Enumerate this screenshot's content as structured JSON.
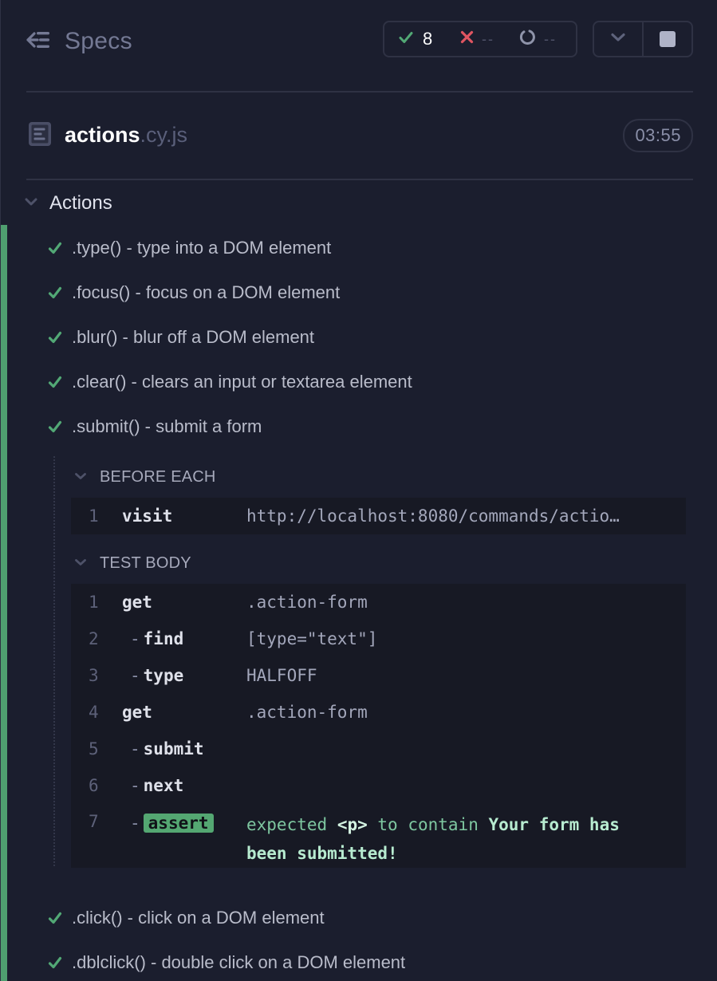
{
  "header": {
    "specs_label": "Specs",
    "stats": {
      "passed": "8",
      "failed": "--",
      "pending": "--"
    },
    "controls": {
      "toggle_icon": "chevron-down-icon",
      "stop_icon": "stop-icon"
    }
  },
  "file": {
    "base": "actions",
    "ext": ".cy.js",
    "duration": "03:55"
  },
  "suite": {
    "title": "Actions",
    "tests_before": [
      {
        "title": ".type() - type into a DOM element",
        "state": "passed"
      },
      {
        "title": ".focus() - focus on a DOM element",
        "state": "passed"
      },
      {
        "title": ".blur() - blur off a DOM element",
        "state": "passed"
      },
      {
        "title": ".clear() - clears an input or textarea element",
        "state": "passed"
      },
      {
        "title": ".submit() - submit a form",
        "state": "passed"
      }
    ],
    "expanded_test": {
      "hooks": [
        {
          "label": "BEFORE EACH",
          "commands": [
            {
              "num": "1",
              "name": "visit",
              "message": "http://localhost:8080/commands/actio…"
            }
          ]
        },
        {
          "label": "TEST BODY",
          "commands": [
            {
              "num": "1",
              "name": "get",
              "message": ".action-form"
            },
            {
              "num": "2",
              "name": "find",
              "message": "[type=\"text\"]"
            },
            {
              "num": "3",
              "name": "type",
              "message": "HALFOFF"
            },
            {
              "num": "4",
              "name": "get",
              "message": ".action-form"
            },
            {
              "num": "5",
              "name": "submit",
              "message": ""
            },
            {
              "num": "6",
              "name": "next",
              "message": ""
            },
            {
              "num": "7",
              "name": "assert",
              "message_parts": {
                "expected": "expected",
                "subject": "<p>",
                "verb": "to contain",
                "value": "Your form has been submitted!"
              }
            }
          ]
        }
      ]
    },
    "tests_after": [
      {
        "title": ".click() - click on a DOM element",
        "state": "passed"
      },
      {
        "title": ".dblclick() - double click on a DOM element",
        "state": "passed"
      }
    ]
  },
  "colors": {
    "background": "#1b1e2e",
    "pass": "#4f9f70",
    "fail": "#e05561",
    "border": "#2f3244",
    "command_bg": "#171924"
  }
}
